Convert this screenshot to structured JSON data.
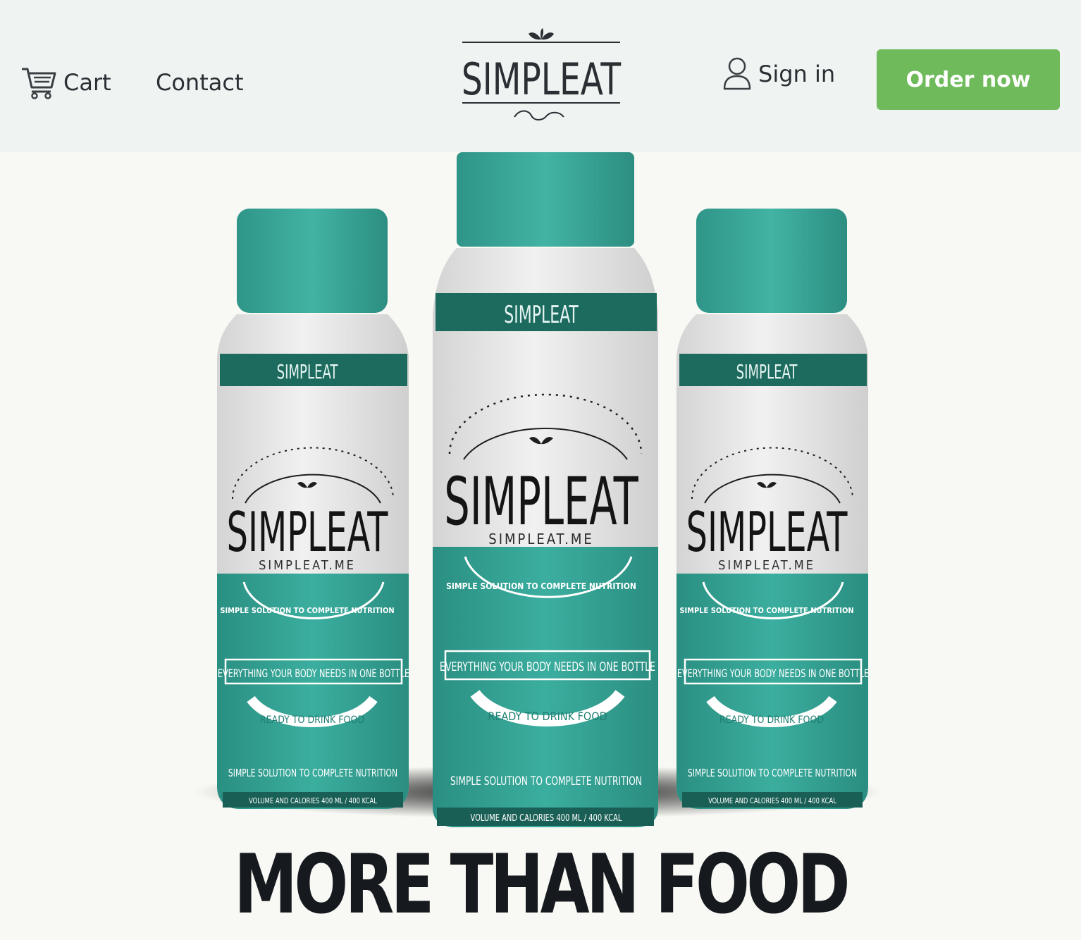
{
  "header": {
    "cart_label": "Cart",
    "contact_label": "Contact",
    "signin_label": "Sign in",
    "order_label": "Order now",
    "logo_text": "SIMPLEAT",
    "icons": {
      "cart": "cart-icon",
      "user": "user-icon",
      "leaf": "leaf-icon"
    },
    "colors": {
      "header_bg": "#eff3f2",
      "order_button": "#6fba5a"
    }
  },
  "hero": {
    "bottles": [
      {
        "band": "SIMPLEAT",
        "brand": "SIMPLEAT",
        "url": "SIMPLEAT.ME",
        "arc": "SIMPLE SOLUTION TO COMPLETE NUTRITION",
        "box": "EVERYTHING YOUR BODY NEEDS IN ONE BOTTLE",
        "ribbon": "READY TO DRINK FOOD",
        "tagline": "SIMPLE SOLUTION TO COMPLETE NUTRITION",
        "volume": "VOLUME AND CALORIES 400 ML / 400 KCAL"
      },
      {
        "band": "SIMPLEAT",
        "brand": "SIMPLEAT",
        "url": "SIMPLEAT.ME",
        "arc": "SIMPLE SOLUTION TO COMPLETE NUTRITION",
        "box": "EVERYTHING YOUR BODY NEEDS IN ONE BOTTLE",
        "ribbon": "READY TO DRINK FOOD",
        "tagline": "SIMPLE SOLUTION TO COMPLETE NUTRITION",
        "volume": "VOLUME AND CALORIES 400 ML / 400 KCAL"
      },
      {
        "band": "SIMPLEAT",
        "brand": "SIMPLEAT",
        "url": "SIMPLEAT.ME",
        "arc": "SIMPLE SOLUTION TO COMPLETE NUTRITION",
        "box": "EVERYTHING YOUR BODY NEEDS IN ONE BOTTLE",
        "ribbon": "READY TO DRINK FOOD",
        "tagline": "SIMPLE SOLUTION TO COMPLETE NUTRITION",
        "volume": "VOLUME AND CALORIES 400 ML / 400 KCAL"
      }
    ],
    "colors": {
      "cap": "#3aa79a",
      "teal": "#33a395",
      "dark_band": "#1d6b5f",
      "label_white": "#e6e6e6"
    }
  },
  "headline": "MORE THAN FOOD"
}
